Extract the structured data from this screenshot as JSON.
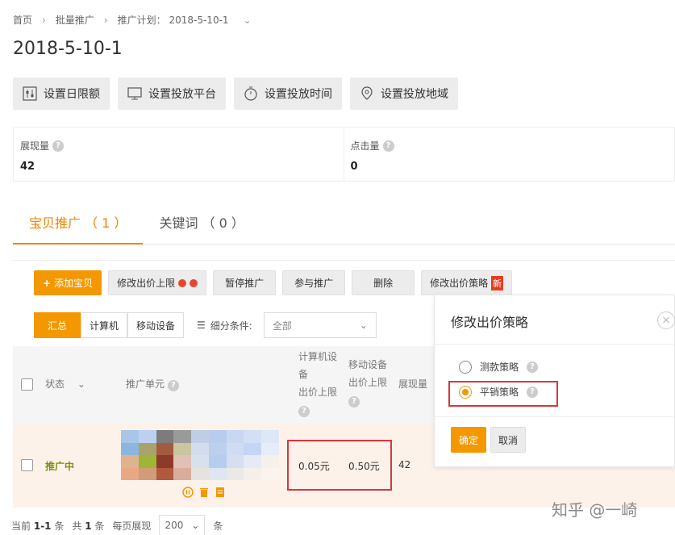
{
  "breadcrumb": {
    "home": "首页",
    "batch": "批量推广",
    "plan": "推广计划： 2018-5-10-1"
  },
  "page_title": "2018-5-10-1",
  "toolbar": {
    "daily_limit": "设置日限额",
    "platform": "设置投放平台",
    "time": "设置投放时间",
    "region": "设置投放地域"
  },
  "stats": {
    "impressions": {
      "label": "展现量",
      "value": "42"
    },
    "clicks": {
      "label": "点击量",
      "value": "0"
    }
  },
  "tabs": {
    "items": "宝贝推广 （ 1 ）",
    "keywords": "关键词 （ 0 ）"
  },
  "actions": {
    "add": "添加宝贝",
    "modify_limit": "修改出价上限",
    "pause": "暂停推广",
    "join": "参与推广",
    "delete": "删除",
    "modify_strategy": "修改出价策略",
    "new_badge": "新"
  },
  "segments": {
    "summary": "汇总",
    "pc": "计算机",
    "mobile": "移动设备"
  },
  "filter": {
    "label": "细分条件:",
    "value": "全部"
  },
  "table": {
    "col_status": "状态",
    "col_unit": "推广单元",
    "col_pc_limit": [
      "计算机设",
      "备",
      "出价上限"
    ],
    "col_mobile_limit": [
      "移动设备",
      "出价上限"
    ],
    "col_impr": "展现量",
    "row": {
      "status": "推广中",
      "pc_limit": "0.05元",
      "mobile_limit": "0.50元",
      "impr": "42"
    }
  },
  "footer": {
    "current": "当前",
    "current_range": "1-1",
    "item": "条",
    "total": "共",
    "total_count": "1",
    "per_page": "每页展现",
    "page_size": "200"
  },
  "popover": {
    "title": "修改出价策略",
    "option1": "测款策略",
    "option2": "平销策略",
    "ok": "确定",
    "cancel": "取消"
  },
  "watermark": "知乎 @一崎",
  "colors": {
    "accent": "#f39800",
    "active_status": "#7d8f12",
    "highlight_box": "#d9363e"
  }
}
